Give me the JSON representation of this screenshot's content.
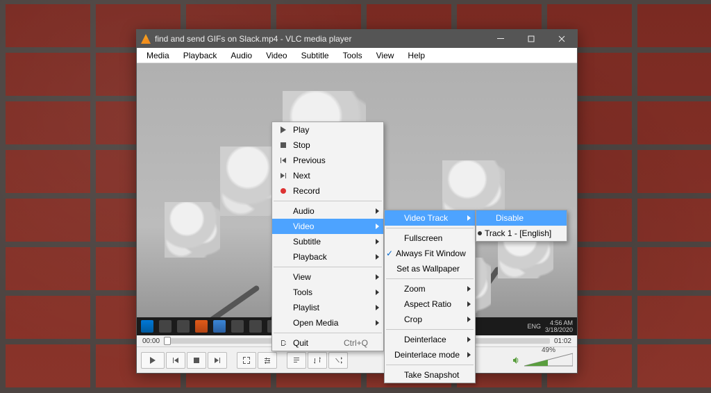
{
  "window": {
    "title": "find and send GIFs on Slack.mp4 - VLC media player"
  },
  "menubar": [
    "Media",
    "Playback",
    "Audio",
    "Video",
    "Subtitle",
    "Tools",
    "View",
    "Help"
  ],
  "progress": {
    "current": "00:00",
    "total": "01:02"
  },
  "volume": {
    "percent": "49%"
  },
  "taskbar": {
    "time": "4:56 AM",
    "date": "3/18/2020",
    "lang": "ENG"
  },
  "context_main": {
    "items": [
      {
        "icon": "play",
        "label": "Play"
      },
      {
        "icon": "stop",
        "label": "Stop"
      },
      {
        "icon": "prev",
        "label": "Previous"
      },
      {
        "icon": "next",
        "label": "Next"
      },
      {
        "icon": "record",
        "label": "Record"
      },
      {
        "sep": true
      },
      {
        "label": "Audio",
        "sub": true
      },
      {
        "label": "Video",
        "sub": true,
        "hl": true
      },
      {
        "label": "Subtitle",
        "sub": true
      },
      {
        "label": "Playback",
        "sub": true
      },
      {
        "sep": true
      },
      {
        "label": "View",
        "sub": true
      },
      {
        "label": "Tools",
        "sub": true
      },
      {
        "label": "Playlist",
        "sub": true
      },
      {
        "label": "Open Media",
        "sub": true
      },
      {
        "sep": true
      },
      {
        "icon": "quit",
        "label": "Quit",
        "shortcut": "Ctrl+Q"
      }
    ]
  },
  "context_video": {
    "items": [
      {
        "label": "Video Track",
        "sub": true,
        "hl": true
      },
      {
        "sep": true
      },
      {
        "label": "Fullscreen"
      },
      {
        "label": "Always Fit Window",
        "checked": true
      },
      {
        "label": "Set as Wallpaper"
      },
      {
        "sep": true
      },
      {
        "label": "Zoom",
        "sub": true
      },
      {
        "label": "Aspect Ratio",
        "sub": true
      },
      {
        "label": "Crop",
        "sub": true
      },
      {
        "sep": true
      },
      {
        "label": "Deinterlace",
        "sub": true
      },
      {
        "label": "Deinterlace mode",
        "sub": true
      },
      {
        "sep": true
      },
      {
        "label": "Take Snapshot"
      }
    ]
  },
  "context_track": {
    "items": [
      {
        "label": "Disable",
        "hl": true
      },
      {
        "label": "Track 1 - [English]",
        "selected": true
      }
    ]
  }
}
